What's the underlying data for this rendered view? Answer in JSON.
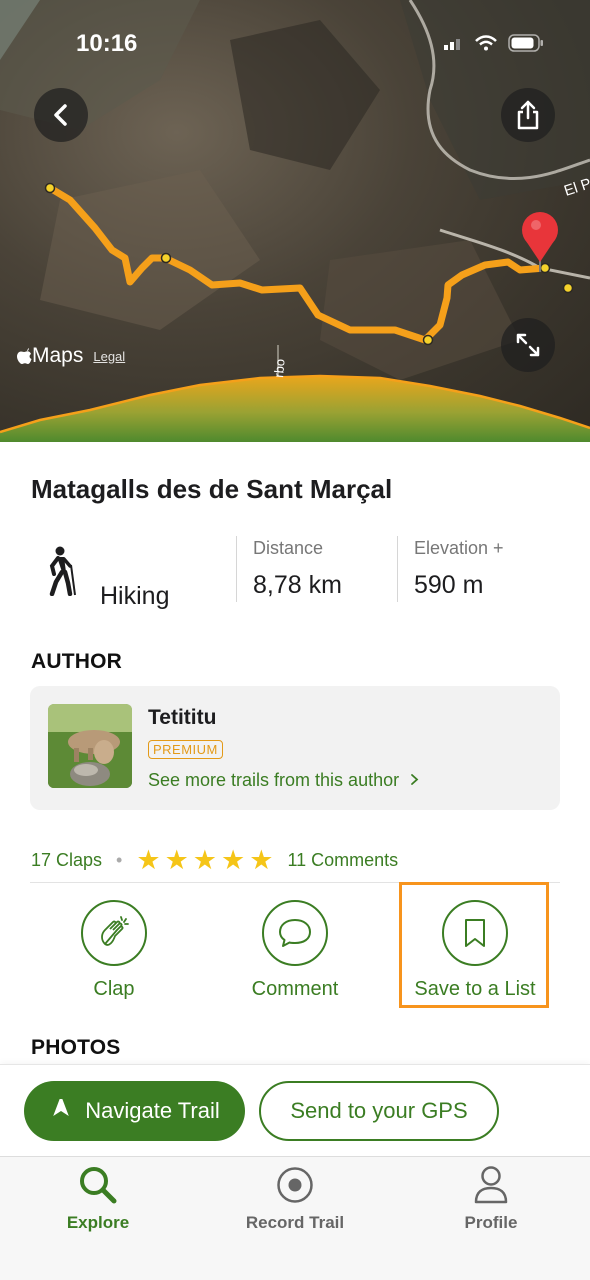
{
  "status": {
    "time": "10:16"
  },
  "map": {
    "maps_label": "Maps",
    "legal_label": "Legal",
    "road_label_right": "El P",
    "road_label_bottom": "rbo"
  },
  "trail": {
    "title": "Matagalls des de Sant Marçal",
    "activity": "Hiking",
    "distance_label": "Distance",
    "distance_value": "8,78 km",
    "elevation_label": "Elevation +",
    "elevation_value": "590 m"
  },
  "author": {
    "section_title": "AUTHOR",
    "name": "Tetititu",
    "badge": "PREMIUM",
    "see_more": "See more trails from this author"
  },
  "engagement": {
    "claps": "17 Claps",
    "rating": 5,
    "comments": "11 Comments"
  },
  "actions": {
    "clap": "Clap",
    "comment": "Comment",
    "save": "Save to a List"
  },
  "photos": {
    "section_title": "PHOTOS"
  },
  "buttons": {
    "navigate": "Navigate Trail",
    "send_gps": "Send to your GPS"
  },
  "tabs": [
    {
      "label": "Explore",
      "icon": "search-icon",
      "active": true
    },
    {
      "label": "Record Trail",
      "icon": "record-icon",
      "active": false
    },
    {
      "label": "Profile",
      "icon": "profile-icon",
      "active": false
    }
  ],
  "colors": {
    "brand_green": "#3b7d23",
    "trail_orange": "#f5a01a",
    "highlight_orange": "#f7941d",
    "star_yellow": "#f5c518"
  }
}
